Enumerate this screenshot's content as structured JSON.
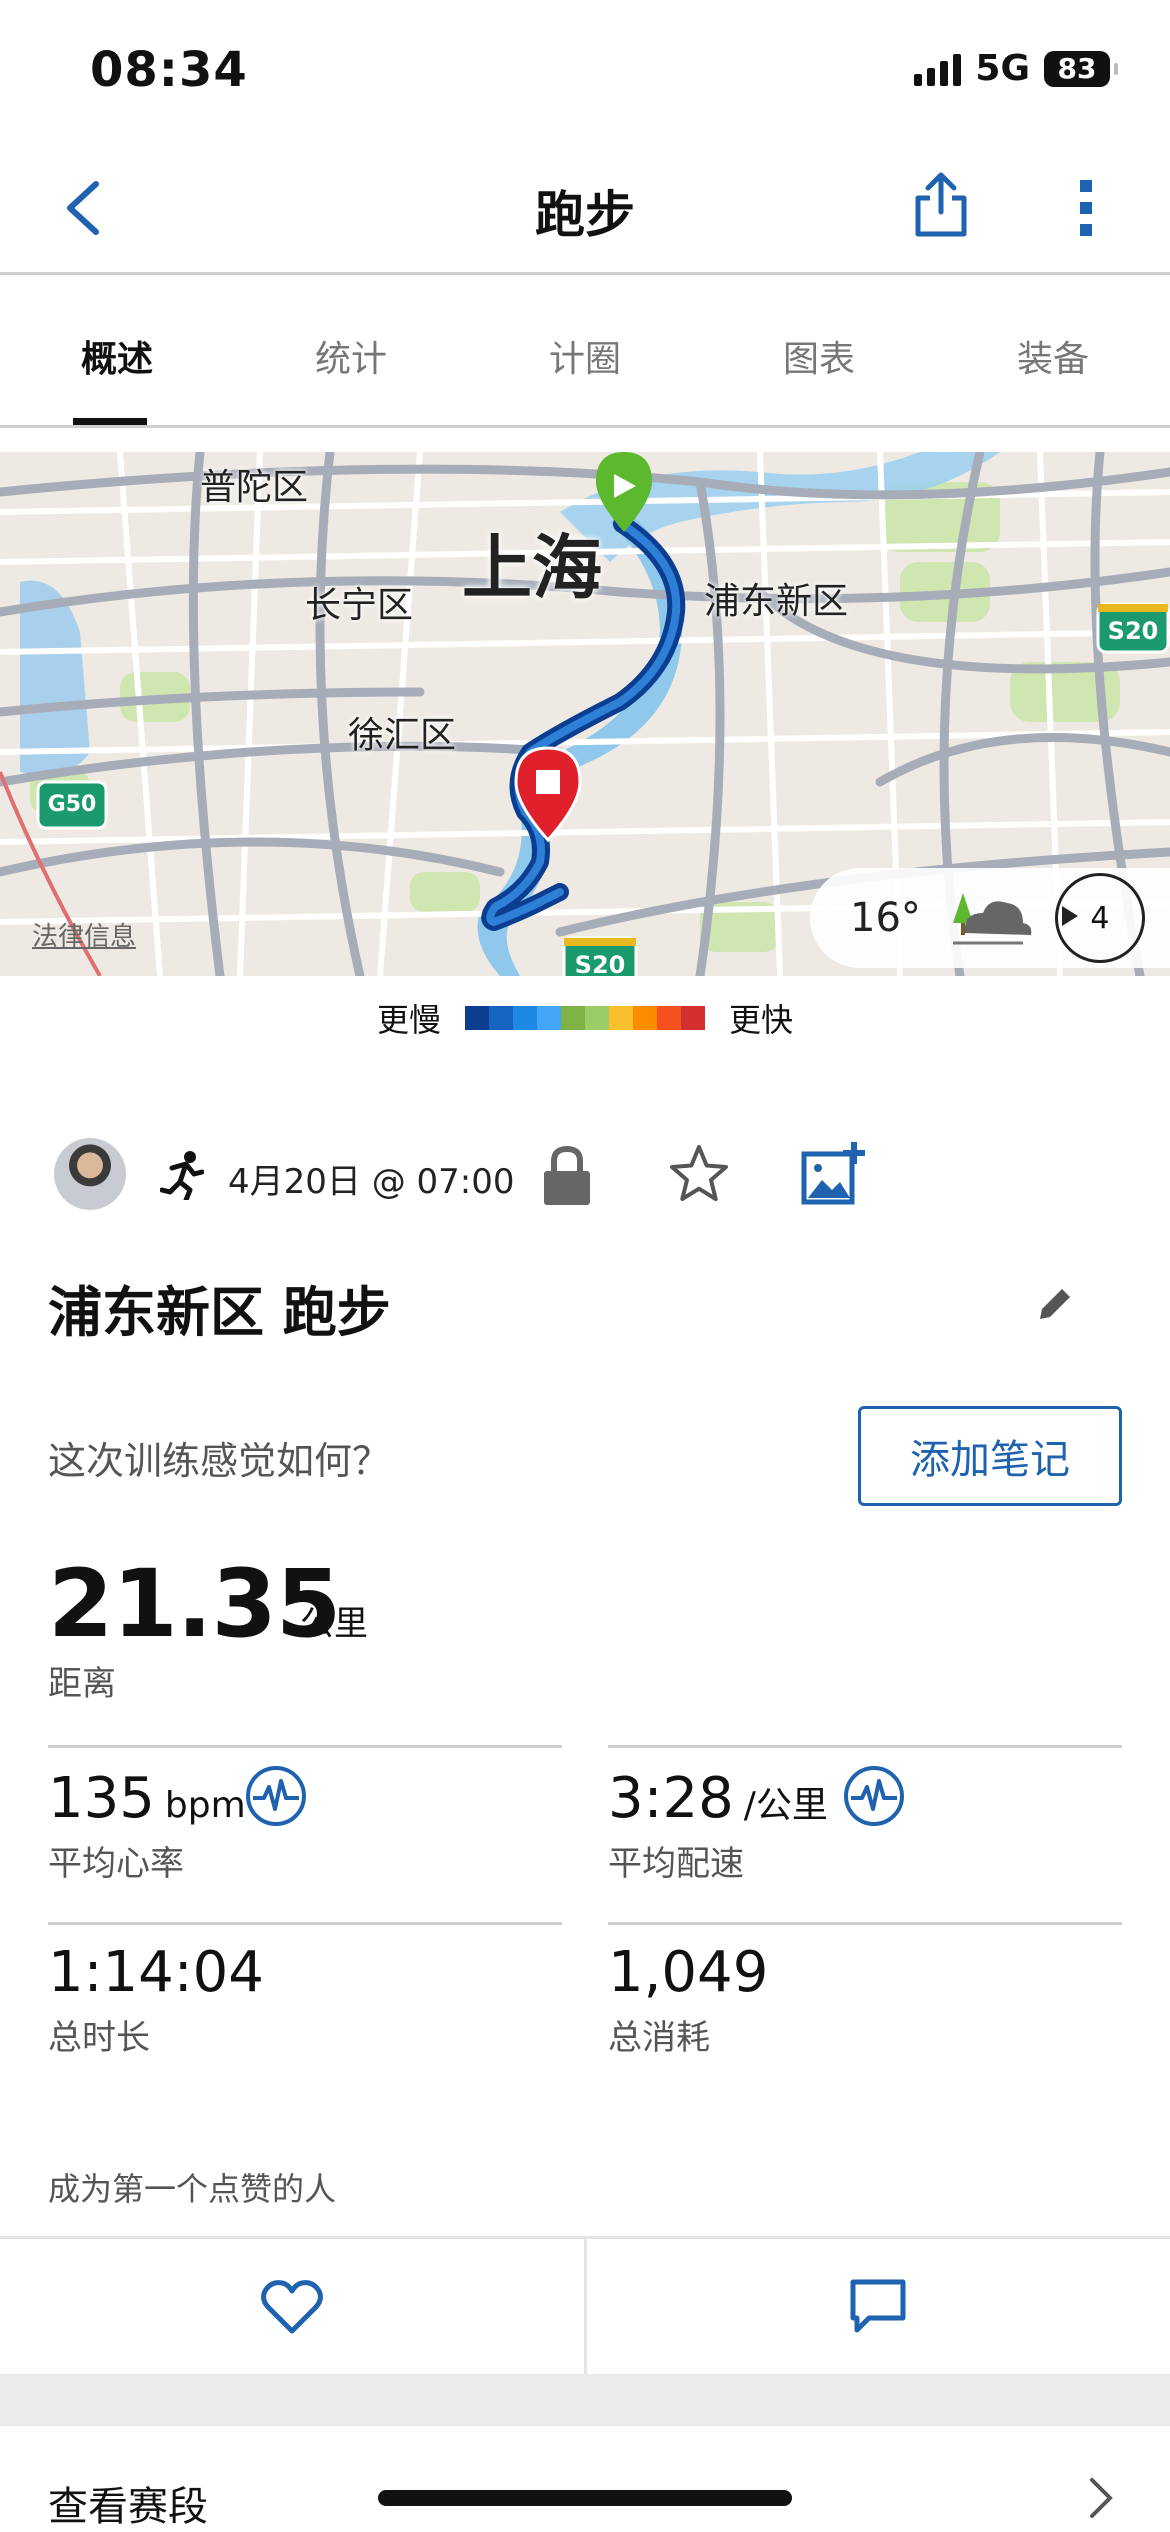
{
  "status": {
    "time": "08:34",
    "network": "5G",
    "battery": "83"
  },
  "nav": {
    "title": "跑步",
    "back_icon": "chevron-left-icon",
    "share_icon": "share-icon",
    "more_icon": "more-vertical-icon"
  },
  "tabs": [
    "概述",
    "统计",
    "计圈",
    "图表",
    "装备"
  ],
  "active_tab": "概述",
  "map": {
    "labels": {
      "putuo": "普陀区",
      "changning": "长宁区",
      "xuhui": "徐汇区",
      "pudong": "浦东新区"
    },
    "city": "上海",
    "shields": {
      "g50": "G50",
      "s20_right": "S20",
      "s20_bottom": "S20"
    },
    "legal": "法律信息",
    "temperature": "16°",
    "wind": "4"
  },
  "legend": {
    "slow": "更慢",
    "fast": "更快",
    "colors": [
      "#0b3d91",
      "#1565c0",
      "#1e88e5",
      "#42a5f5",
      "#7cb342",
      "#9ccc65",
      "#fbc02d",
      "#fb8c00",
      "#f4511e",
      "#d32f2f"
    ]
  },
  "activity": {
    "date": "4月20日 @ 07:00",
    "title": "浦东新区 跑步",
    "question": "这次训练感觉如何？",
    "note_button": "添加笔记"
  },
  "distance": {
    "value": "21.35",
    "unit": "公里",
    "label": "距离"
  },
  "stats": {
    "hr": {
      "value": "135",
      "unit": "bpm",
      "label": "平均心率"
    },
    "pace": {
      "value": "3:28",
      "unit": "/公里",
      "label": "平均配速"
    },
    "duration": {
      "value": "1:14:04",
      "label": "总时长"
    },
    "calories": {
      "value": "1,049",
      "label": "总消耗"
    }
  },
  "likes_text": "成为第一个点赞的人",
  "segments_label": "查看赛段",
  "accent": "#1e62b0"
}
